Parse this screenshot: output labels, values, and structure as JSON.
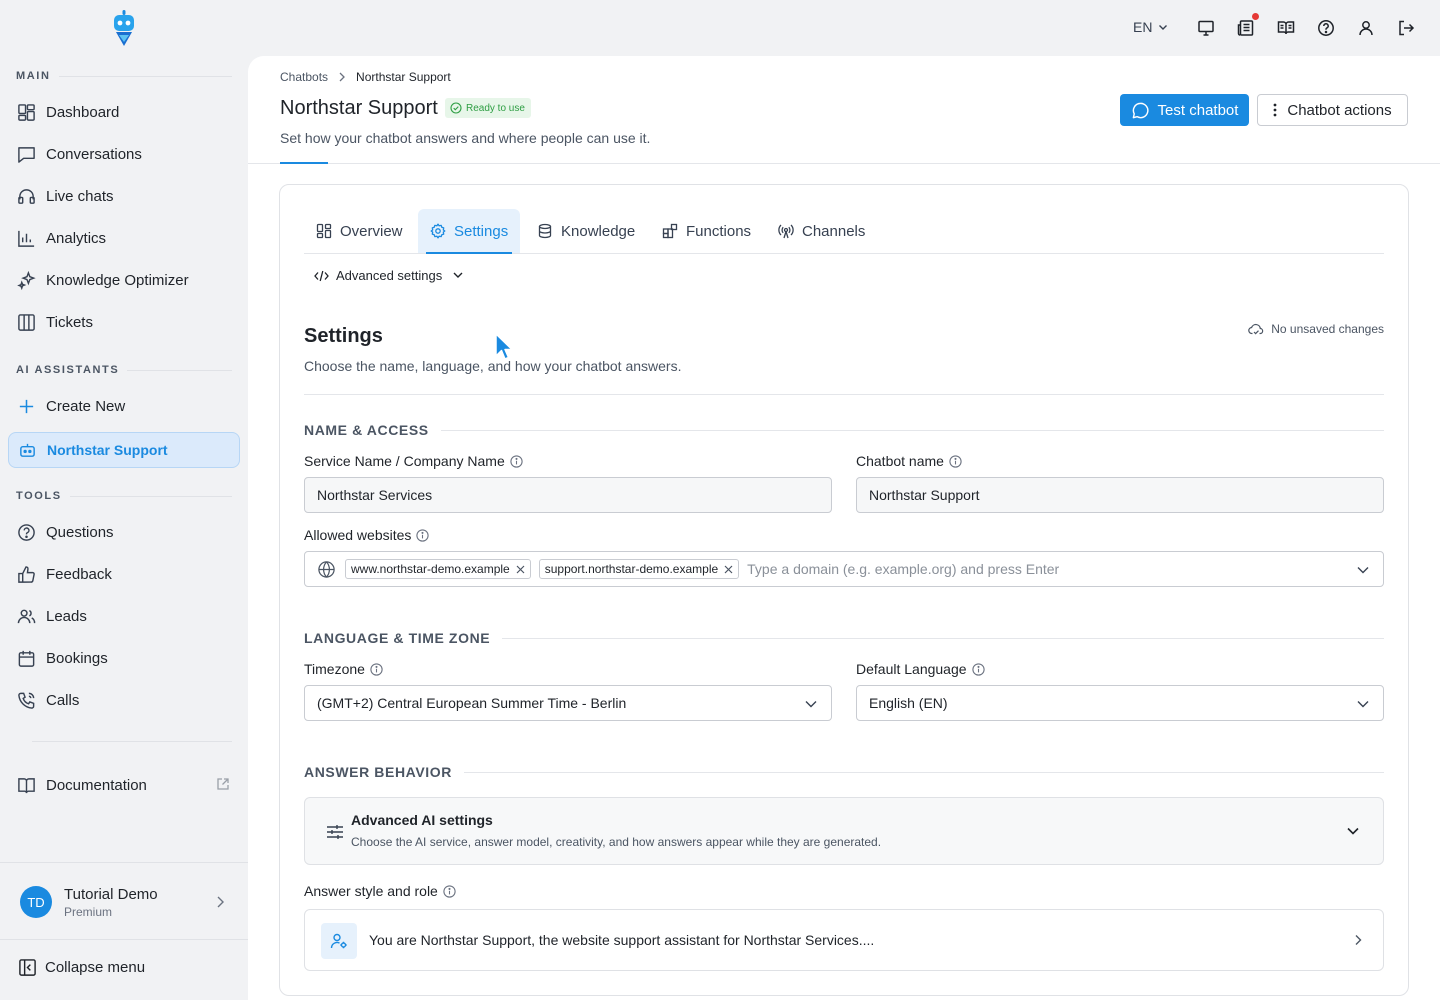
{
  "sidebar": {
    "sections": {
      "main": "MAIN",
      "ai": "AI ASSISTANTS",
      "tools": "TOOLS"
    },
    "main_items": [
      {
        "label": "Dashboard",
        "icon": "dashboard-icon"
      },
      {
        "label": "Conversations",
        "icon": "chat-bubble-icon"
      },
      {
        "label": "Live chats",
        "icon": "headset-icon"
      },
      {
        "label": "Analytics",
        "icon": "bar-chart-icon"
      },
      {
        "label": "Knowledge Optimizer",
        "icon": "sparkle-icon"
      },
      {
        "label": "Tickets",
        "icon": "columns-icon"
      }
    ],
    "ai_items": [
      {
        "label": "Create New",
        "icon": "plus-icon"
      },
      {
        "label": "Northstar Support",
        "icon": "bot-icon",
        "active": true
      }
    ],
    "tool_items": [
      {
        "label": "Questions",
        "icon": "question-circle-icon"
      },
      {
        "label": "Feedback",
        "icon": "thumbs-up-icon"
      },
      {
        "label": "Leads",
        "icon": "users-icon"
      },
      {
        "label": "Bookings",
        "icon": "calendar-icon"
      },
      {
        "label": "Calls",
        "icon": "phone-icon"
      }
    ],
    "documentation": "Documentation",
    "user": {
      "initials": "TD",
      "name": "Tutorial Demo",
      "plan": "Premium"
    },
    "collapse": "Collapse menu"
  },
  "topbar": {
    "language": "EN",
    "icons": [
      "monitor-icon",
      "news-icon",
      "book-open-icon",
      "help-icon",
      "user-icon",
      "logout-icon"
    ]
  },
  "header": {
    "breadcrumb": [
      "Chatbots",
      "Northstar Support"
    ],
    "title": "Northstar Support",
    "badge": "Ready to use",
    "subtitle": "Set how your chatbot answers and where people can use it.",
    "test_button": "Test chatbot",
    "actions_button": "Chatbot actions"
  },
  "tabs": [
    {
      "label": "Overview",
      "icon": "grid-icon"
    },
    {
      "label": "Settings",
      "icon": "gear-icon",
      "active": true
    },
    {
      "label": "Knowledge",
      "icon": "database-icon"
    },
    {
      "label": "Functions",
      "icon": "blocks-icon"
    },
    {
      "label": "Channels",
      "icon": "broadcast-icon"
    }
  ],
  "advanced_toggle": "Advanced settings",
  "settings": {
    "title": "Settings",
    "subtitle": "Choose the name, language, and how your chatbot answers.",
    "save_status": "No unsaved changes",
    "groups": {
      "name_access": "NAME & ACCESS",
      "language_tz": "LANGUAGE & TIME ZONE",
      "answer_behavior": "ANSWER BEHAVIOR"
    },
    "fields": {
      "service_name": {
        "label": "Service Name / Company Name",
        "value": "Northstar Services"
      },
      "chatbot_name": {
        "label": "Chatbot name",
        "value": "Northstar Support"
      },
      "allowed_websites": {
        "label": "Allowed websites",
        "chips": [
          "www.northstar-demo.example",
          "support.northstar-demo.example"
        ],
        "placeholder": "Type a domain (e.g. example.org) and press Enter"
      },
      "timezone": {
        "label": "Timezone",
        "value": "(GMT+2) Central European Summer Time - Berlin"
      },
      "default_language": {
        "label": "Default Language",
        "value": "English (EN)"
      }
    },
    "advanced_ai": {
      "title": "Advanced AI settings",
      "description": "Choose the AI service, answer model, creativity, and how answers appear while they are generated."
    },
    "answer_style": {
      "label": "Answer style and role",
      "preview": "You are Northstar Support, the website support assistant for Northstar Services...."
    }
  },
  "colors": {
    "accent": "#1a8ae0",
    "success": "#2e9e43",
    "background": "#f1f2f4"
  }
}
